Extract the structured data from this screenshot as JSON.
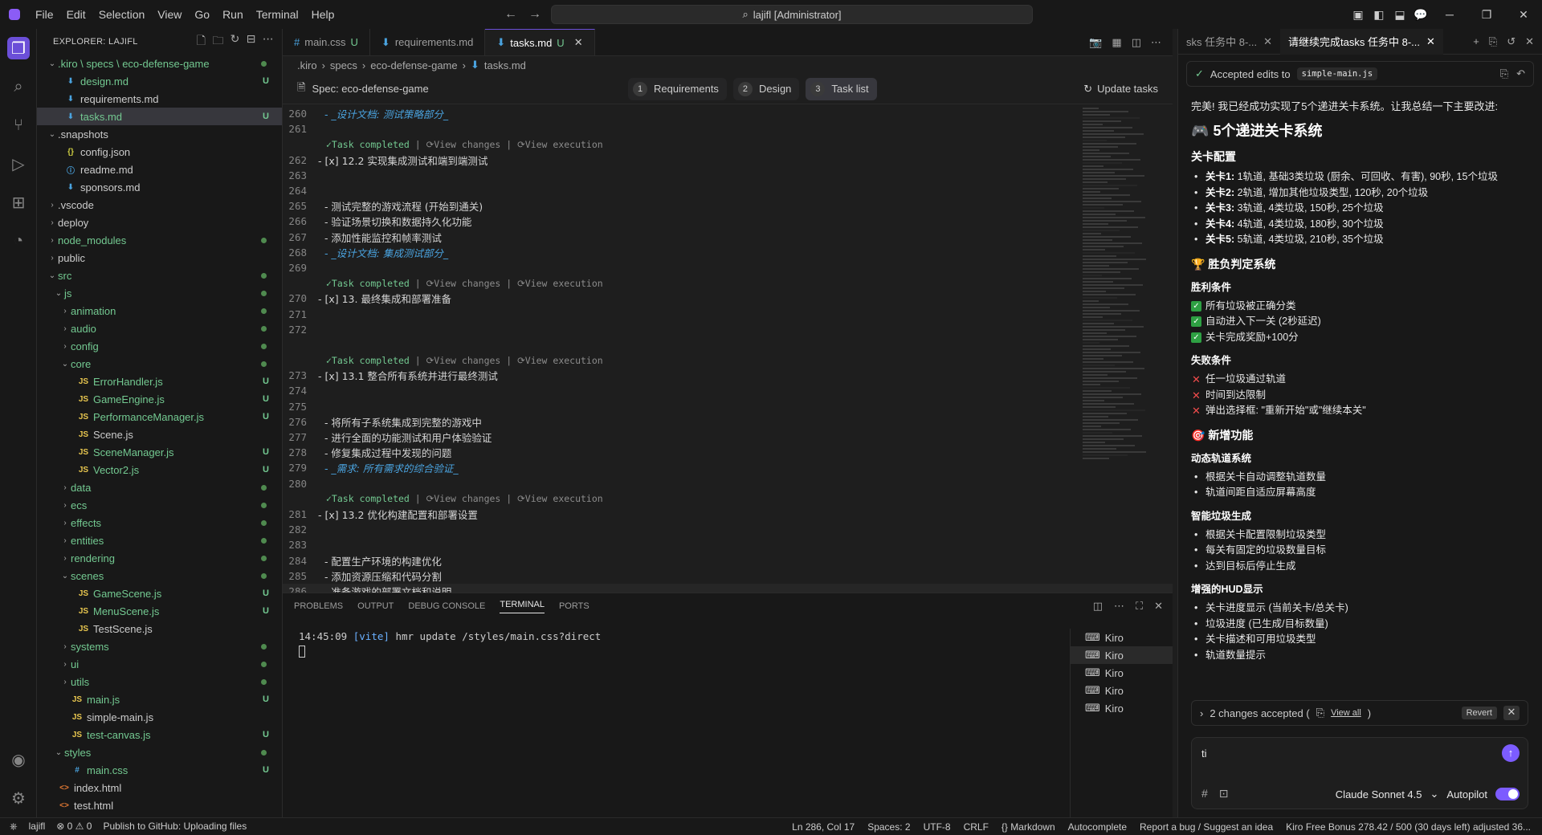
{
  "menu": [
    "File",
    "Edit",
    "Selection",
    "View",
    "Go",
    "Run",
    "Terminal",
    "Help"
  ],
  "command_center": "lajifl [Administrator]",
  "explorer": {
    "title": "EXPLORER: LAJIFL",
    "items": [
      {
        "label": ".kiro \\ specs \\ eco-defense-game",
        "kind": "folder-open",
        "indent": 0,
        "color": "green",
        "badge": "dot"
      },
      {
        "label": "design.md",
        "kind": "md",
        "indent": 1,
        "color": "green",
        "badge": "U"
      },
      {
        "label": "requirements.md",
        "kind": "md",
        "indent": 1,
        "color": "normal",
        "badge": ""
      },
      {
        "label": "tasks.md",
        "kind": "md",
        "indent": 1,
        "color": "green",
        "badge": "U",
        "selected": true
      },
      {
        "label": ".snapshots",
        "kind": "folder-open",
        "indent": 0,
        "color": "normal",
        "badge": ""
      },
      {
        "label": "config.json",
        "kind": "json",
        "indent": 1,
        "color": "normal",
        "badge": ""
      },
      {
        "label": "readme.md",
        "kind": "info",
        "indent": 1,
        "color": "normal",
        "badge": ""
      },
      {
        "label": "sponsors.md",
        "kind": "md",
        "indent": 1,
        "color": "normal",
        "badge": ""
      },
      {
        "label": ".vscode",
        "kind": "folder",
        "indent": 0,
        "color": "normal",
        "badge": ""
      },
      {
        "label": "deploy",
        "kind": "folder",
        "indent": 0,
        "color": "normal",
        "badge": ""
      },
      {
        "label": "node_modules",
        "kind": "folder",
        "indent": 0,
        "color": "green",
        "badge": "dot"
      },
      {
        "label": "public",
        "kind": "folder",
        "indent": 0,
        "color": "normal",
        "badge": ""
      },
      {
        "label": "src",
        "kind": "folder-open",
        "indent": 0,
        "color": "green",
        "badge": "dot"
      },
      {
        "label": "js",
        "kind": "folder-open",
        "indent": 1,
        "color": "green",
        "badge": "dot"
      },
      {
        "label": "animation",
        "kind": "folder",
        "indent": 2,
        "color": "green",
        "badge": "dot"
      },
      {
        "label": "audio",
        "kind": "folder",
        "indent": 2,
        "color": "green",
        "badge": "dot"
      },
      {
        "label": "config",
        "kind": "folder",
        "indent": 2,
        "color": "green",
        "badge": "dot"
      },
      {
        "label": "core",
        "kind": "folder-open",
        "indent": 2,
        "color": "green",
        "badge": "dot"
      },
      {
        "label": "ErrorHandler.js",
        "kind": "js",
        "indent": 3,
        "color": "green",
        "badge": "U"
      },
      {
        "label": "GameEngine.js",
        "kind": "js",
        "indent": 3,
        "color": "green",
        "badge": "U"
      },
      {
        "label": "PerformanceManager.js",
        "kind": "js",
        "indent": 3,
        "color": "green",
        "badge": "U"
      },
      {
        "label": "Scene.js",
        "kind": "js",
        "indent": 3,
        "color": "normal",
        "badge": ""
      },
      {
        "label": "SceneManager.js",
        "kind": "js",
        "indent": 3,
        "color": "green",
        "badge": "U"
      },
      {
        "label": "Vector2.js",
        "kind": "js",
        "indent": 3,
        "color": "green",
        "badge": "U"
      },
      {
        "label": "data",
        "kind": "folder",
        "indent": 2,
        "color": "green",
        "badge": "dot"
      },
      {
        "label": "ecs",
        "kind": "folder",
        "indent": 2,
        "color": "green",
        "badge": "dot"
      },
      {
        "label": "effects",
        "kind": "folder",
        "indent": 2,
        "color": "green",
        "badge": "dot"
      },
      {
        "label": "entities",
        "kind": "folder",
        "indent": 2,
        "color": "green",
        "badge": "dot"
      },
      {
        "label": "rendering",
        "kind": "folder",
        "indent": 2,
        "color": "green",
        "badge": "dot"
      },
      {
        "label": "scenes",
        "kind": "folder-open",
        "indent": 2,
        "color": "green",
        "badge": "dot"
      },
      {
        "label": "GameScene.js",
        "kind": "js",
        "indent": 3,
        "color": "green",
        "badge": "U"
      },
      {
        "label": "MenuScene.js",
        "kind": "js",
        "indent": 3,
        "color": "green",
        "badge": "U"
      },
      {
        "label": "TestScene.js",
        "kind": "js",
        "indent": 3,
        "color": "normal",
        "badge": ""
      },
      {
        "label": "systems",
        "kind": "folder",
        "indent": 2,
        "color": "green",
        "badge": "dot"
      },
      {
        "label": "ui",
        "kind": "folder",
        "indent": 2,
        "color": "green",
        "badge": "dot"
      },
      {
        "label": "utils",
        "kind": "folder",
        "indent": 2,
        "color": "green",
        "badge": "dot"
      },
      {
        "label": "main.js",
        "kind": "js",
        "indent": 2,
        "color": "green",
        "badge": "U"
      },
      {
        "label": "simple-main.js",
        "kind": "js",
        "indent": 2,
        "color": "normal",
        "badge": ""
      },
      {
        "label": "test-canvas.js",
        "kind": "js",
        "indent": 2,
        "color": "green",
        "badge": "U"
      },
      {
        "label": "styles",
        "kind": "folder-open",
        "indent": 1,
        "color": "green",
        "badge": "dot"
      },
      {
        "label": "main.css",
        "kind": "css",
        "indent": 2,
        "color": "green",
        "badge": "U"
      },
      {
        "label": "index.html",
        "kind": "html",
        "indent": 0,
        "color": "normal",
        "badge": ""
      },
      {
        "label": "test.html",
        "kind": "html",
        "indent": 0,
        "color": "normal",
        "badge": ""
      }
    ]
  },
  "tabs": [
    {
      "label": "main.css",
      "icon": "#",
      "status": "U",
      "active": false
    },
    {
      "label": "requirements.md",
      "icon": "md",
      "status": "",
      "active": false
    },
    {
      "label": "tasks.md",
      "icon": "md",
      "status": "U",
      "active": true
    }
  ],
  "breadcrumb": [
    ".kiro",
    "specs",
    "eco-defense-game",
    "tasks.md"
  ],
  "spec": {
    "title": "Spec: eco-defense-game",
    "steps": [
      {
        "n": "1",
        "label": "Requirements"
      },
      {
        "n": "2",
        "label": "Design"
      },
      {
        "n": "3",
        "label": "Task list",
        "active": true
      }
    ],
    "update": "Update tasks"
  },
  "lens": {
    "completed": "Task completed",
    "changes": "View changes",
    "execution": "View execution"
  },
  "code_lines": [
    {
      "n": "260",
      "text": "  - _设计文档: 测试策略部分_",
      "style": "link"
    },
    {
      "n": "261",
      "text": ""
    },
    {
      "n": "",
      "lens": true
    },
    {
      "n": "262",
      "text": "- [x] 12.2 实现集成测试和端到端测试"
    },
    {
      "n": "263",
      "text": ""
    },
    {
      "n": "264",
      "text": ""
    },
    {
      "n": "265",
      "text": "  - 测试完整的游戏流程 (开始到通关)"
    },
    {
      "n": "266",
      "text": "  - 验证场景切换和数据持久化功能"
    },
    {
      "n": "267",
      "text": "  - 添加性能监控和帧率测试"
    },
    {
      "n": "268",
      "text": "  - _设计文档: 集成测试部分_",
      "style": "link"
    },
    {
      "n": "269",
      "text": ""
    },
    {
      "n": "",
      "lens": true
    },
    {
      "n": "270",
      "text": "- [x] 13. 最终集成和部署准备"
    },
    {
      "n": "271",
      "text": ""
    },
    {
      "n": "272",
      "text": ""
    },
    {
      "n": "",
      "text": ""
    },
    {
      "n": "",
      "lens": true
    },
    {
      "n": "273",
      "text": "- [x] 13.1 整合所有系统并进行最终测试"
    },
    {
      "n": "274",
      "text": ""
    },
    {
      "n": "275",
      "text": ""
    },
    {
      "n": "276",
      "text": "  - 将所有子系统集成到完整的游戏中"
    },
    {
      "n": "277",
      "text": "  - 进行全面的功能测试和用户体验验证"
    },
    {
      "n": "278",
      "text": "  - 修复集成过程中发现的问题"
    },
    {
      "n": "279",
      "text": "  - _需求: 所有需求的综合验证_",
      "style": "link"
    },
    {
      "n": "280",
      "text": ""
    },
    {
      "n": "",
      "lens": true
    },
    {
      "n": "281",
      "text": "- [x] 13.2 优化构建配置和部署设置"
    },
    {
      "n": "282",
      "text": ""
    },
    {
      "n": "283",
      "text": ""
    },
    {
      "n": "284",
      "text": "  - 配置生产环境的构建优化"
    },
    {
      "n": "285",
      "text": "  - 添加资源压缩和代码分割"
    },
    {
      "n": "286",
      "text": "  - 准备游戏的部署文档和说明",
      "current": true
    }
  ],
  "panel": {
    "tabs": [
      "PROBLEMS",
      "OUTPUT",
      "DEBUG CONSOLE",
      "TERMINAL",
      "PORTS"
    ],
    "active": "TERMINAL",
    "terminal": {
      "time": "14:45:09",
      "tag": "[vite]",
      "msg": "hmr update /styles/main.css?direct"
    },
    "terminals": [
      "Kiro",
      "Kiro",
      "Kiro",
      "Kiro",
      "Kiro"
    ]
  },
  "chat": {
    "tabs": [
      "sks 任务中 8-...",
      "请继续完成tasks 任务中 8-..."
    ],
    "accepted_label": "Accepted edits to",
    "accepted_file": "simple-main.js",
    "intro": "完美! 我已经成功实现了5个递进关卡系统。让我总结一下主要改进:",
    "h_levels": "5个递进关卡系统",
    "h_levels_icon": "🎮",
    "h_level_cfg": "关卡配置",
    "levels": [
      {
        "b": "关卡1:",
        "t": " 1轨道, 基础3类垃圾 (厨余、可回收、有害), 90秒, 15个垃圾"
      },
      {
        "b": "关卡2:",
        "t": " 2轨道, 增加其他垃圾类型, 120秒, 20个垃圾"
      },
      {
        "b": "关卡3:",
        "t": " 3轨道, 4类垃圾, 150秒, 25个垃圾"
      },
      {
        "b": "关卡4:",
        "t": " 4轨道, 4类垃圾, 180秒, 30个垃圾"
      },
      {
        "b": "关卡5:",
        "t": " 5轨道, 4类垃圾, 210秒, 35个垃圾"
      }
    ],
    "h_judge": "胜负判定系统",
    "h_judge_icon": "🏆",
    "h_win": "胜利条件",
    "win": [
      "所有垃圾被正确分类",
      "自动进入下一关 (2秒延迟)",
      "关卡完成奖励+100分"
    ],
    "h_lose": "失败条件",
    "lose": [
      "任一垃圾通过轨道",
      "时间到达限制",
      "弹出选择框: \"重新开始\"或\"继续本关\""
    ],
    "h_new": "新增功能",
    "h_new_icon": "🎯",
    "h_dyn": "动态轨道系统",
    "dyn": [
      "根据关卡自动调整轨道数量",
      "轨道间距自适应屏幕高度"
    ],
    "h_smart": "智能垃圾生成",
    "smart": [
      "根据关卡配置限制垃圾类型",
      "每关有固定的垃圾数量目标",
      "达到目标后停止生成"
    ],
    "h_hud": "增强的HUD显示",
    "hud": [
      "关卡进度显示 (当前关卡/总关卡)",
      "垃圾进度 (已生成/目标数量)",
      "关卡描述和可用垃圾类型",
      "轨道数量提示"
    ],
    "changes": "2 changes accepted (",
    "view_all": "View all",
    "changes_close": ")",
    "revert": "Revert",
    "input_value": "ti",
    "model": "Claude Sonnet 4.5",
    "autopilot": "Autopilot"
  },
  "status": {
    "left": [
      "lajifl",
      "⊗ 0 ⚠ 0",
      "Publish to GitHub: Uploading files"
    ],
    "right": [
      "Ln 286, Col 17",
      "Spaces: 2",
      "UTF-8",
      "CRLF",
      "{} Markdown",
      "Autocomplete",
      "Report a bug / Suggest an idea",
      "Kiro Free Bonus 278.42 / 500 (30 days left) adjusted 36..."
    ]
  }
}
